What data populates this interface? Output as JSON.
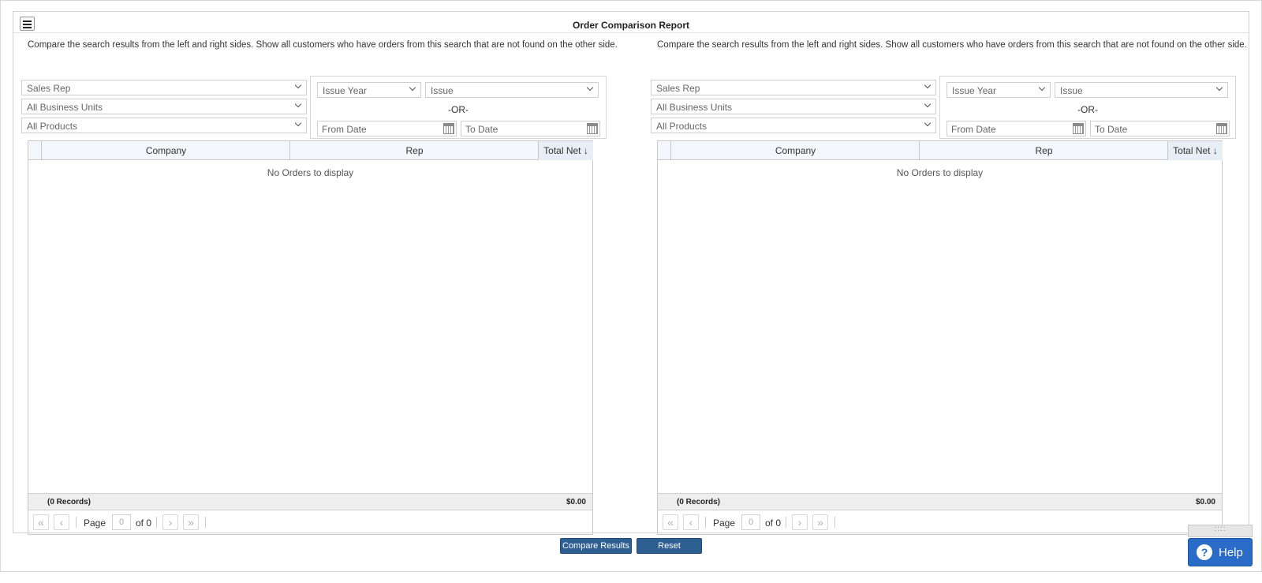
{
  "title": "Order Comparison Report",
  "panels": [
    {
      "description": "Compare the search results from the left and right sides. Show all customers who have orders from this search that are not found on the other side.",
      "sales_rep": "Sales Rep",
      "business_units": "All Business Units",
      "products": "All Products",
      "issue_year": "Issue Year",
      "issue": "Issue",
      "or_label": "-OR-",
      "from_date": "From Date",
      "to_date": "To Date",
      "columns": [
        "Company",
        "Rep",
        "Total Net ↓"
      ],
      "empty_message": "No Orders to display",
      "records": "(0 Records)",
      "total": "$0.00",
      "page_label": "Page",
      "page_value": "0",
      "of_label": "of 0"
    },
    {
      "description": "Compare the search results from the left and right sides. Show all customers who have orders from this search that are not found on the other side.",
      "sales_rep": "Sales Rep",
      "business_units": "All Business Units",
      "products": "All Products",
      "issue_year": "Issue Year",
      "issue": "Issue",
      "or_label": "-OR-",
      "from_date": "From Date",
      "to_date": "To Date",
      "columns": [
        "Company",
        "Rep",
        "Total Net ↓"
      ],
      "empty_message": "No Orders to display",
      "records": "(0 Records)",
      "total": "$0.00",
      "page_label": "Page",
      "page_value": "0",
      "of_label": "of 0"
    }
  ],
  "buttons": {
    "compare": "Compare Results",
    "reset": "Reset"
  },
  "help": {
    "label": "Help",
    "icon": "?"
  }
}
